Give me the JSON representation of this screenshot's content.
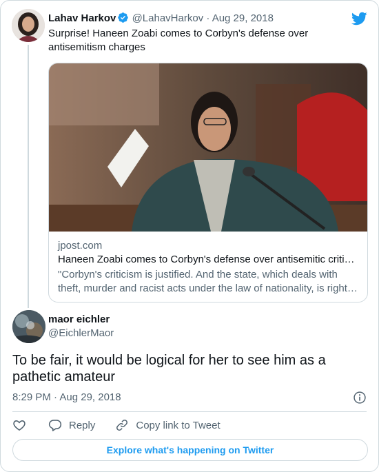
{
  "parent": {
    "name": "Lahav Harkov",
    "handle": "@LahavHarkov",
    "separator": "·",
    "date": "Aug 29, 2018",
    "text": "Surprise! Haneen Zoabi comes to Corbyn's defense over antisemitism charges",
    "avatar_icon": "user-avatar",
    "verified_icon": "verified-badge-icon",
    "link_card": {
      "domain": "jpost.com",
      "title": "Haneen Zoabi comes to Corbyn's defense over antisemitic criti…",
      "desc_line1": "\"Corbyn's criticism is justified. And the state, which deals with",
      "desc_line2": "theft, murder and racist acts under the law of nationality, is right…"
    }
  },
  "reply": {
    "name": "maor eichler",
    "handle": "@EichlerMaor",
    "text": "To be fair, it would be logical for her to see him as a pathetic amateur",
    "timestamp": "8:29 PM · Aug 29, 2018",
    "avatar_icon": "user-avatar"
  },
  "actions": {
    "like_icon": "heart-icon",
    "reply_label": "Reply",
    "reply_icon": "reply-icon",
    "copy_label": "Copy link to Tweet",
    "copy_icon": "link-icon"
  },
  "explore_label": "Explore what's happening on Twitter",
  "colors": {
    "accent": "#1d9bf0",
    "text": "#0f1419",
    "secondary": "#536471",
    "border": "#cfd9de"
  }
}
